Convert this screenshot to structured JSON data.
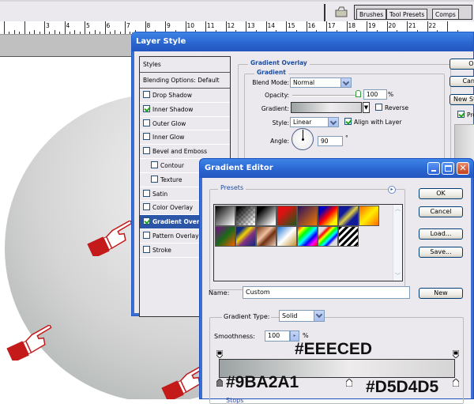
{
  "app": {
    "palette_well_tabs": [
      "Brushes",
      "Tool Presets",
      "Comps"
    ],
    "ruler_numbers": [
      "3",
      "4",
      "5",
      "6",
      "7",
      "8",
      "9",
      "10",
      "11",
      "12",
      "13",
      "14",
      "15",
      "16",
      "17",
      "18",
      "19",
      "20",
      "21",
      "22"
    ]
  },
  "layer_style": {
    "title": "Layer Style",
    "styles_header": "Styles",
    "blending_options": "Blending Options: Default",
    "effects": [
      {
        "label": "Drop Shadow",
        "checked": false,
        "indent": false
      },
      {
        "label": "Inner Shadow",
        "checked": true,
        "indent": false
      },
      {
        "label": "Outer Glow",
        "checked": false,
        "indent": false
      },
      {
        "label": "Inner Glow",
        "checked": false,
        "indent": false
      },
      {
        "label": "Bevel and Emboss",
        "checked": false,
        "indent": false
      },
      {
        "label": "Contour",
        "checked": false,
        "indent": true
      },
      {
        "label": "Texture",
        "checked": false,
        "indent": true
      },
      {
        "label": "Satin",
        "checked": false,
        "indent": false
      },
      {
        "label": "Color Overlay",
        "checked": false,
        "indent": false
      },
      {
        "label": "Gradient Overlay",
        "checked": true,
        "indent": false,
        "selected": true
      },
      {
        "label": "Pattern Overlay",
        "checked": false,
        "indent": false
      },
      {
        "label": "Stroke",
        "checked": false,
        "indent": false
      }
    ],
    "section_title": "Gradient Overlay",
    "group_title": "Gradient",
    "blend_mode_label": "Blend Mode:",
    "blend_mode_value": "Normal",
    "opacity_label": "Opacity:",
    "opacity_value": "100",
    "opacity_unit": "%",
    "opacity_fraction": 1.0,
    "gradient_label": "Gradient:",
    "reverse_label": "Reverse",
    "reverse_checked": false,
    "style_label": "Style:",
    "style_value": "Linear",
    "align_label": "Align with Layer",
    "align_checked": true,
    "angle_label": "Angle:",
    "angle_value": "90",
    "angle_unit": "°",
    "buttons": {
      "ok": "OK",
      "cancel": "Cancel",
      "new_style": "New Style...",
      "preview": "Preview"
    },
    "preview_checked": true
  },
  "gradient_editor": {
    "title": "Gradient Editor",
    "presets_label": "Presets",
    "buttons": {
      "ok": "OK",
      "cancel": "Cancel",
      "load": "Load...",
      "save": "Save...",
      "new": "New"
    },
    "name_label": "Name:",
    "name_value": "Custom",
    "gradient_type_label": "Gradient Type:",
    "gradient_type_value": "Solid",
    "smoothness_label": "Smoothness:",
    "smoothness_value": "100",
    "smoothness_unit": "%",
    "stops_label": "Stops",
    "color_stops": [
      {
        "position": 0.0,
        "color": "#9BA2A1"
      },
      {
        "position": 0.55,
        "color": "#EEECED"
      },
      {
        "position": 1.0,
        "color": "#D5D4D5"
      }
    ],
    "annotations": {
      "top": "#EEECED",
      "left": "#9BA2A1",
      "right": "#D5D4D5"
    },
    "preset_swatches": [
      "linear-gradient(135deg,#000,#fff)",
      "linear-gradient(135deg,#000 10%,rgba(0,0,0,0) 90%)",
      "linear-gradient(135deg,#000 20%,#fff 90%)",
      "linear-gradient(135deg,#d11 30%,#1a5a1a)",
      "linear-gradient(135deg,#2a1060,#f07a00)",
      "linear-gradient(135deg,#0000c0 20%,#ff0000 50%,#ffee00 80%)",
      "linear-gradient(135deg,#101a9a 30%,#e0d040 50%,#101a9a 70%)",
      "linear-gradient(135deg,#ff6a00,#ffee00 50%,#ff6a00)",
      "linear-gradient(135deg,#7a0a8a,#1a6a1a 50%,#f06000)",
      "linear-gradient(135deg,#102a80 20%,#f0d000 40%,#803080 60%,#102a80)",
      "linear-gradient(135deg,#703010,#f0c0a0 40%,#703010 60%,#f0d0c0)",
      "linear-gradient(135deg,#1a70d0,#fff 50%,#c09030)",
      "linear-gradient(135deg,#f00,#ff0,#0f0,#0ff,#00f,#f0f,#f00)",
      "linear-gradient(135deg,#ddd 20%,#f00,#ff0,#0f0,#0ff,#00f,#ddd 80%)",
      "repeating-linear-gradient(135deg,#000 0 3px,#fff 3px 6px)"
    ]
  }
}
